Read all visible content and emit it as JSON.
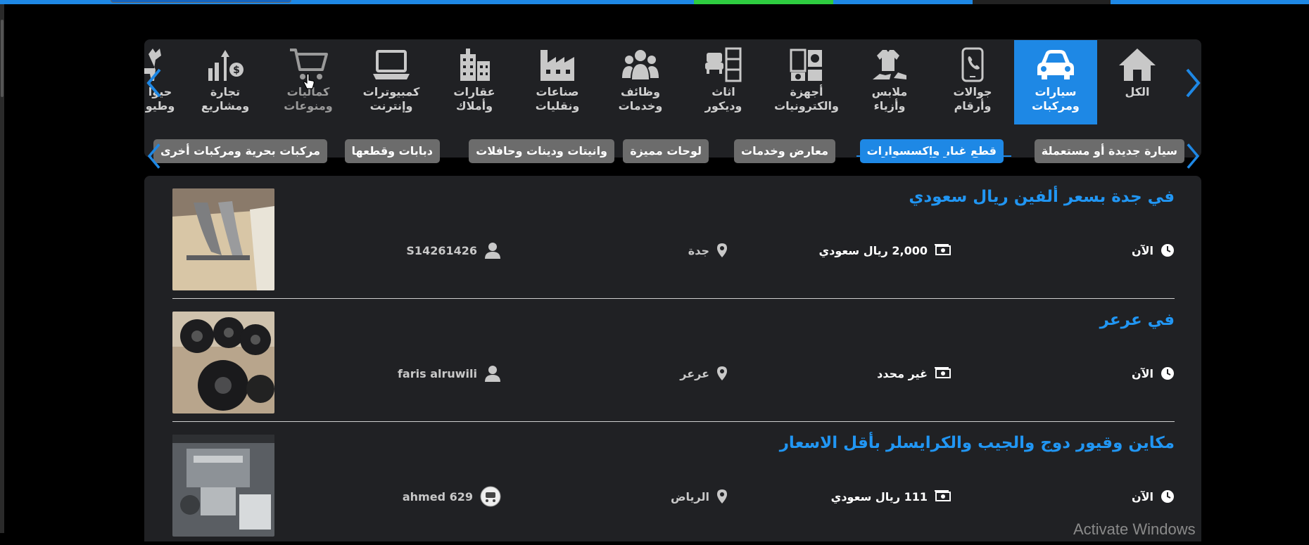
{
  "colors": {
    "accent": "#1e88e5",
    "link": "#2196f3",
    "panel": "#202124",
    "chip": "#6c6c6c"
  },
  "categories": [
    {
      "label": "الكل",
      "icon": "home-icon"
    },
    {
      "label": "سيارات\nومركبات",
      "icon": "car-icon"
    },
    {
      "label": "جوالات\nوأرقام",
      "icon": "phone-icon"
    },
    {
      "label": "ملابس\nوأزياء",
      "icon": "clothes-icon"
    },
    {
      "label": "أجهزة\nوالكترونيات",
      "icon": "appliances-icon"
    },
    {
      "label": "اثاث\nوديكور",
      "icon": "furniture-icon"
    },
    {
      "label": "وظائف\nوخدمات",
      "icon": "people-icon"
    },
    {
      "label": "صناعات\nونقليات",
      "icon": "factory-icon"
    },
    {
      "label": "عقارات\nوأملاك",
      "icon": "building-icon"
    },
    {
      "label": "كمبيوترات\nوإنترنت",
      "icon": "laptop-icon"
    },
    {
      "label": "كماليات\nومنوعات",
      "icon": "cart-icon"
    },
    {
      "label": "تجارة\nومشاريع",
      "icon": "money-chart-icon"
    },
    {
      "label": "حيوا\nوطيو",
      "icon": "animals-icon"
    }
  ],
  "subcategories": [
    {
      "label": "سيارة جديدة أو مستعملة"
    },
    {
      "label": "قطع غيار وإكسسوارات"
    },
    {
      "label": "معارض وخدمات"
    },
    {
      "label": "لوحات مميزة"
    },
    {
      "label": "وانيتات ودينات وحافلات"
    },
    {
      "label": "دبابات وقطعها"
    },
    {
      "label": "مركبات بحرية ومركبات أخرى"
    }
  ],
  "listings": [
    {
      "title": "في جدة بسعر ألفين ريال سعودي",
      "time": "الآن",
      "price": "2,000 ريال سعودي",
      "location": "جدة",
      "user": "S14261426"
    },
    {
      "title": "في عرعر",
      "time": "الآن",
      "price": "غير محدد",
      "location": "عرعر",
      "user": "faris alruwili"
    },
    {
      "title": "مكاين وقيور دوج والجيب والكرايسلر بأقل الاسعار",
      "time": "الآن",
      "price": "111 ريال سعودي",
      "location": "الرياض",
      "user": "ahmed 629"
    }
  ],
  "watermark": "Activate Windows"
}
